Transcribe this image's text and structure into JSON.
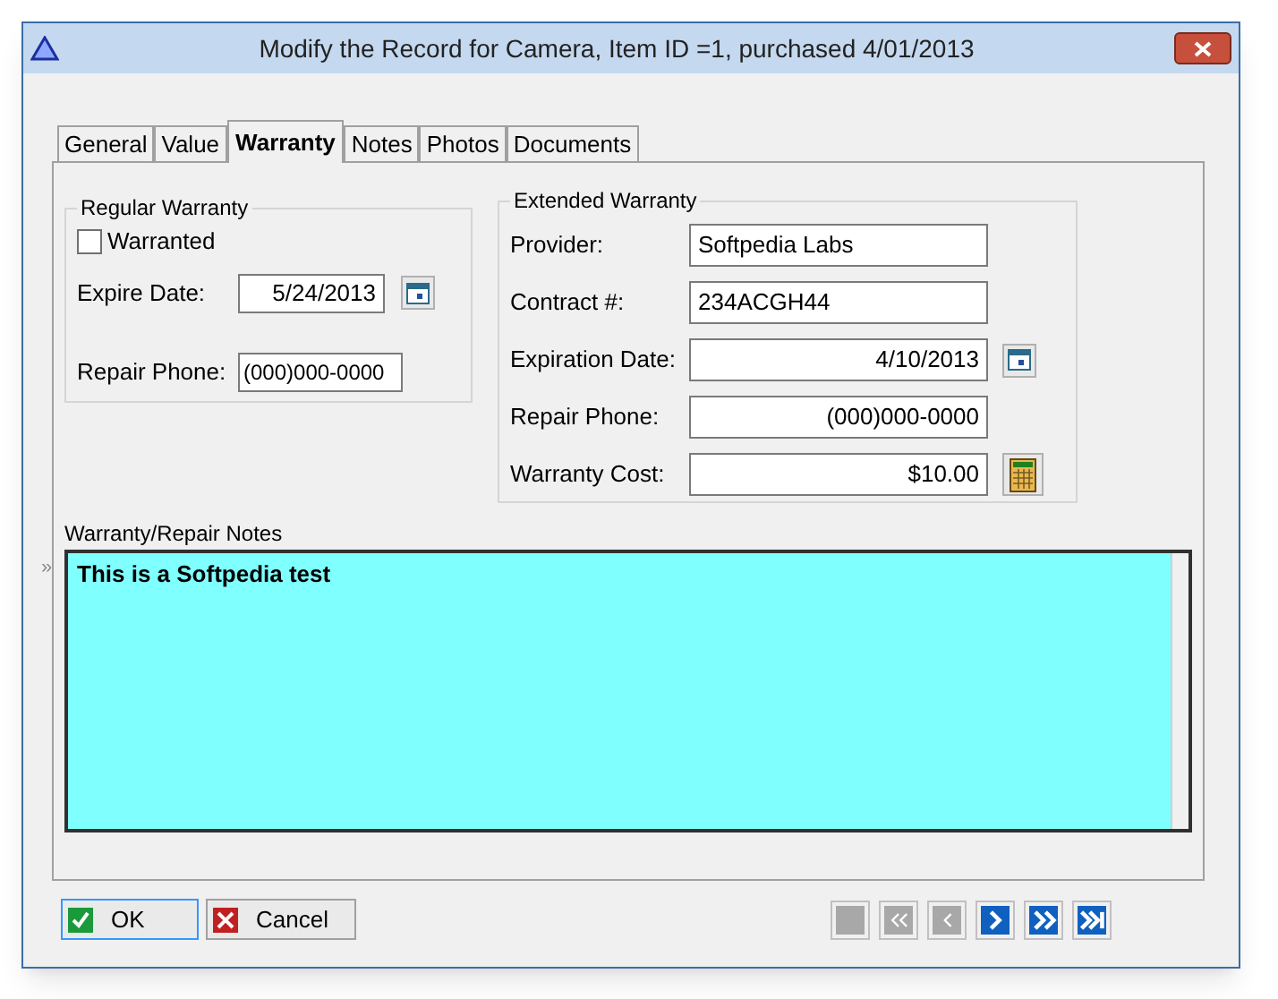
{
  "window": {
    "title": "Modify the Record for Camera, Item ID =1, purchased 4/01/2013"
  },
  "tabs": [
    {
      "label": "General",
      "selected": false
    },
    {
      "label": "Value",
      "selected": false
    },
    {
      "label": "Warranty",
      "selected": true
    },
    {
      "label": "Notes",
      "selected": false
    },
    {
      "label": "Photos",
      "selected": false
    },
    {
      "label": "Documents",
      "selected": false
    }
  ],
  "regular_warranty": {
    "title": "Regular Warranty",
    "warranted": {
      "label": "Warranted",
      "checked": false
    },
    "expire_date": {
      "label": "Expire Date:",
      "value": "5/24/2013"
    },
    "repair_phone": {
      "label": "Repair Phone:",
      "value": "(000)000-0000"
    }
  },
  "extended_warranty": {
    "title": "Extended Warranty",
    "fields": [
      {
        "label": "Provider:",
        "value": "Softpedia Labs",
        "kind": "text"
      },
      {
        "label": "Contract #:",
        "value": "234ACGH44",
        "kind": "text"
      },
      {
        "label": "Expiration Date:",
        "value": "4/10/2013",
        "kind": "date"
      },
      {
        "label": "Repair Phone:",
        "value": "(000)000-0000",
        "kind": "phone"
      },
      {
        "label": "Warranty Cost:",
        "value": "$10.00",
        "kind": "money"
      }
    ]
  },
  "notes": {
    "label": "Warranty/Repair Notes",
    "marker": "»",
    "value": "This is a Softpedia test"
  },
  "buttons": [
    {
      "label": "OK",
      "kind": "ok"
    },
    {
      "label": "Cancel",
      "kind": "cancel"
    }
  ],
  "navigation": [
    {
      "kind": "first",
      "disabled": true
    },
    {
      "kind": "fast-back",
      "disabled": true
    },
    {
      "kind": "back",
      "disabled": true
    },
    {
      "kind": "next",
      "disabled": false
    },
    {
      "kind": "fast-next",
      "disabled": false
    },
    {
      "kind": "last",
      "disabled": false
    }
  ]
}
